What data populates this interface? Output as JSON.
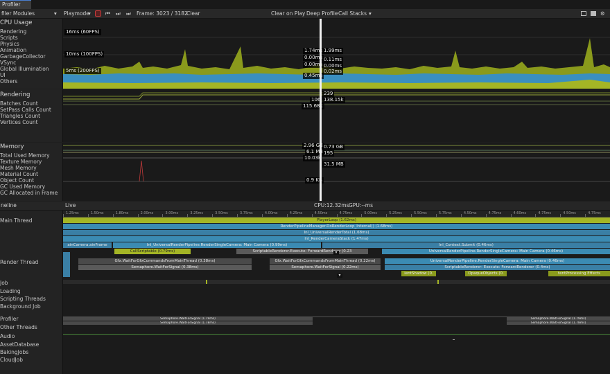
{
  "window": {
    "tab_label": "Profiler"
  },
  "toolbar": {
    "modules_label": "filer Modules",
    "playmode_label": "Playmode",
    "frame_label": "Frame: 3023 / 3182",
    "clear_label": "Clear",
    "clear_on_play_label": "Clear on Play",
    "deep_profile_label": "Deep Profile",
    "call_stacks_label": "Call Stacks"
  },
  "cpu": {
    "title": "CPU Usage",
    "items": [
      "Rendering",
      "Scripts",
      "Physics",
      "Animation",
      "GarbageCollector",
      "VSync",
      "Global Illumination",
      "UI",
      "Others"
    ],
    "threshold_labels": [
      "16ms (60FPS)",
      "10ms (100FPS)",
      "5ms (200FPS)"
    ],
    "cursor_values_left": [
      "1.74ms",
      "0.00ms",
      "0.00ms",
      "0.45ms"
    ],
    "cursor_values_right": [
      "1.99ms",
      "0.11ms",
      "0.00ms",
      "0.02ms"
    ]
  },
  "rendering": {
    "title": "Rendering",
    "items": [
      "Batches Count",
      "SetPass Calls Count",
      "Triangles Count",
      "Vertices Count"
    ],
    "cursor_values_left": [
      "106",
      "115.68k"
    ],
    "cursor_values_right": [
      "239",
      "138.15k"
    ]
  },
  "memory": {
    "title": "Memory",
    "items": [
      "Total Used Memory",
      "Texture Memory",
      "Mesh Memory",
      "Material Count",
      "Object Count",
      "GC Used Memory",
      "GC Allocated in Frame"
    ],
    "cursor_values_left": [
      "2.96 GB",
      "6.1 MB",
      "10.03k",
      "0.9 KB"
    ],
    "cursor_values_right": [
      "0.73 GB",
      "195",
      "31.5 MB"
    ]
  },
  "timeline": {
    "view_label": "neline",
    "live_label": "Live",
    "cpu_label": "CPU:12.32ms",
    "gpu_label": "GPU:--ms",
    "ticks": [
      "1.25ms",
      "1.50ms",
      "1.80ms",
      "2.00ms",
      "3.00ms",
      "3.25ms",
      "3.50ms",
      "3.75ms",
      "4.00ms",
      "4.25ms",
      "4.50ms",
      "4.75ms",
      "5.00ms",
      "5.25ms",
      "5.50ms",
      "5.75ms",
      "4.50ms",
      "4.75ms",
      "4.60ms",
      "4.75ms",
      "4.50ms",
      "4.75ms"
    ],
    "threads": [
      "Main Thread",
      "Render Thread",
      "Job",
      "Loading",
      "Scripting Threads",
      "Background Job",
      "Profiler",
      "Other Threads",
      "Audio",
      "AssetDatabase",
      "BakingJobs",
      "CloudJob"
    ],
    "main_blocks": {
      "player_loop": "PlayerLoop (1.62ms)",
      "rp_render": "RenderPipelineManager.DoRenderLoop_Internal() (1.68ms)",
      "inl_render": "Inl_UniversalRenderTotal (1.68ms)",
      "inl_cameras": "Inl_RenderCameraStack (1.47ms)",
      "inl_single_left": "Inl_UniversalRenderPipeline.RenderSingleCamera: Main Camera (0.99ms)",
      "inl_submit": "Inl_Context.Submit (0.46ms)",
      "main_camera": "ainCamera.ainFrame",
      "cull": "CullScriptable (0.79ms)",
      "scriptable_exec": "ScriptableRenderer.Execute: ForwardRenderer (0.23",
      "urp_right": "UniversalRenderPipeline.RenderSingleCamera: Main Camera (0.46ms)"
    },
    "render_blocks": {
      "gfx_wait_left": "Gfx.WaitForGfxCommandsFromMainThread (0.38ms)",
      "sema_left": "Semaphore.WaitForSignal (0.38ms)",
      "gfx_wait_mid": "Gfx.WaitForGfxCommandsFromMainThread (0.22ms)",
      "sema_mid": "Semaphore.WaitForSignal (0.22ms)",
      "urp_render": "UniversalRenderPipeline.RenderSingleCamera: Main Camera (0.46ms)",
      "scriptable_render": "ScriptableRenderer: Execute: ForwardRenderer (0.4ms)",
      "shadow": "ientShadow (0.",
      "opaque": "OpaqueObjects (0.",
      "post": "tentProcessing Effects"
    },
    "profiler_blocks": {
      "sema_a": "Semaphore.WaitForSignal (1.79ms)",
      "sema_b": "Semaphore.WaitForSignal (1.78ms)",
      "sema_c": "Semaphore.WaitForSignal (1.79ms)",
      "sema_d": "Semaphore.WaitForSignal (1.78ms)"
    }
  },
  "colors": {
    "rendering": "#a4b525",
    "scripts": "#3a8fbf",
    "others": "#8a9a1c",
    "cursor": "#ffffff"
  }
}
